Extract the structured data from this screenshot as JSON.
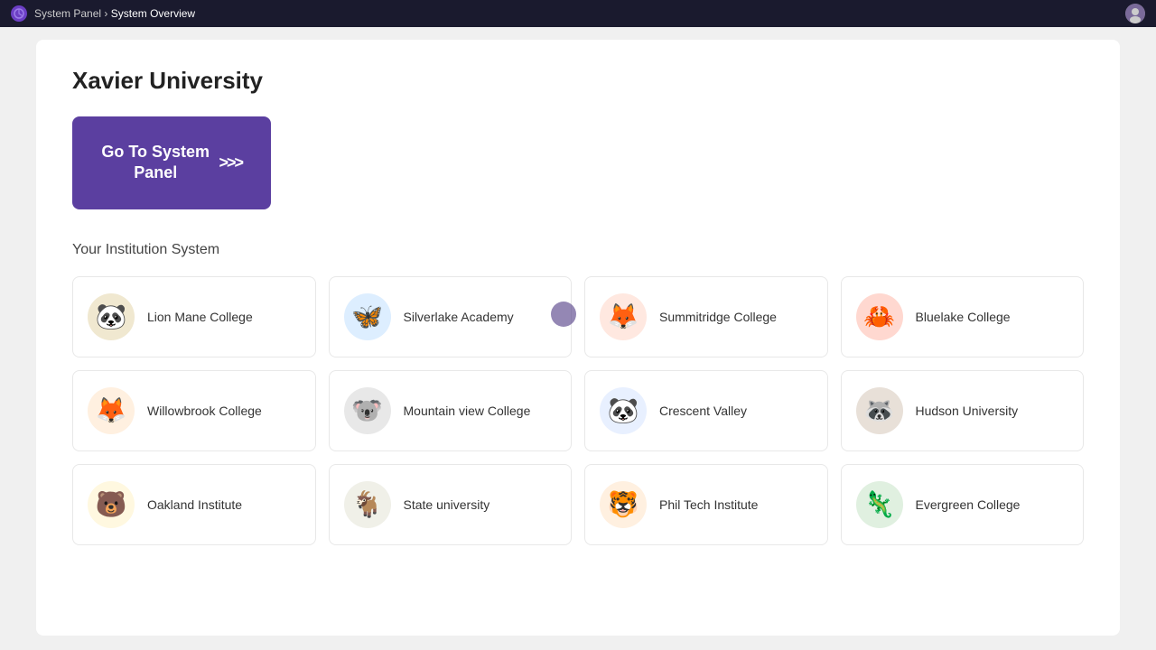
{
  "topbar": {
    "breadcrumb_parent": "System Panel",
    "breadcrumb_separator": " › ",
    "breadcrumb_current": "System Overview",
    "logo_icon": "gear-icon"
  },
  "page": {
    "title": "Xavier University",
    "go_to_panel_label": "Go To System Panel",
    "go_to_panel_chevrons": ">>>",
    "section_title": "Your Institution System"
  },
  "institutions": [
    {
      "name": "Lion Mane College",
      "emoji": "🐼",
      "icon_class": "icon-lion",
      "id": "lion-mane"
    },
    {
      "name": "Silverlake Academy",
      "emoji": "🦋",
      "icon_class": "icon-bird",
      "id": "silverlake"
    },
    {
      "name": "Summitridge College",
      "emoji": "🦊",
      "icon_class": "icon-fox-red",
      "id": "summitridge"
    },
    {
      "name": "Bluelake College",
      "emoji": "🦀",
      "icon_class": "icon-crab",
      "id": "bluelake"
    },
    {
      "name": "Willowbrook College",
      "emoji": "🦊",
      "icon_class": "icon-fox",
      "id": "willowbrook"
    },
    {
      "name": "Mountain view College",
      "emoji": "🐨",
      "icon_class": "icon-koala",
      "id": "mountain-view"
    },
    {
      "name": "Crescent Valley",
      "emoji": "🐼",
      "icon_class": "icon-panda",
      "id": "crescent-valley"
    },
    {
      "name": "Hudson University",
      "emoji": "🦝",
      "icon_class": "icon-raccoon",
      "id": "hudson"
    },
    {
      "name": "Oakland Institute",
      "emoji": "🐻",
      "icon_class": "icon-bear",
      "id": "oakland"
    },
    {
      "name": "State university",
      "emoji": "🐐",
      "icon_class": "icon-goat",
      "id": "state-university"
    },
    {
      "name": "Phil Tech Institute",
      "emoji": "🐯",
      "icon_class": "icon-tiger",
      "id": "phil-tech"
    },
    {
      "name": "Evergreen College",
      "emoji": "🦎",
      "icon_class": "icon-dino",
      "id": "evergreen"
    }
  ]
}
